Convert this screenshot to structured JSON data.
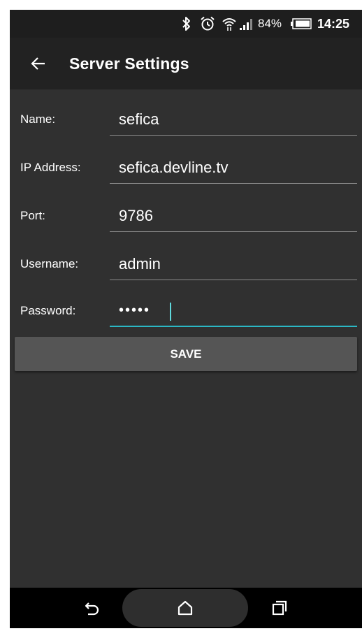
{
  "status_bar": {
    "battery_percent": "84%",
    "time": "14:25",
    "icons": [
      "bluetooth-icon",
      "alarm-icon",
      "wifi-icon",
      "signal-icon",
      "battery-icon"
    ]
  },
  "toolbar": {
    "title": "Server Settings",
    "back_icon": "arrow-left-icon"
  },
  "form": {
    "name": {
      "label": "Name:",
      "value": "sefica"
    },
    "ip_address": {
      "label": "IP Address:",
      "value": "sefica.devline.tv"
    },
    "port": {
      "label": "Port:",
      "value": "9786"
    },
    "username": {
      "label": "Username:",
      "value": "admin"
    },
    "password": {
      "label": "Password:",
      "value": "•••••",
      "focused": true
    }
  },
  "save_button": {
    "label": "SAVE"
  },
  "nav_bar": {
    "icons": [
      "back-icon",
      "home-icon",
      "recent-apps-icon"
    ]
  },
  "colors": {
    "background": "#303030",
    "toolbar": "#222222",
    "button": "#555555",
    "accent": "#2bb7c4"
  }
}
